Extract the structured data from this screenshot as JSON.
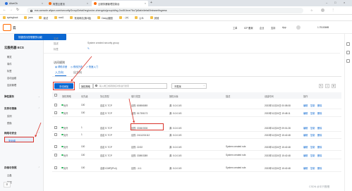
{
  "browser": {
    "tabs": [
      {
        "label": "AliveOh",
        "active": false
      },
      {
        "label": "阿里云首页",
        "active": false
      },
      {
        "label": "云服务器管理控制台",
        "active": true
      }
    ],
    "url": "ecs.console.aliyun.com/securityGroupDetail/region/cn-chengdu/groupId/sg-2vc5l1bxe76u7jx5afz/detail/intranetIngress",
    "bookmarks": [
      "springboot",
      "java",
      "我试",
      "rust1",
      "常用网站(第2组)",
      "Deep(截图",
      "…(n)",
      "公众",
      "其他"
    ]
  },
  "console": {
    "logo_text": "云",
    "popup_text": "快捷查找您想要的功能",
    "header_right": [
      "工单",
      "ICP 备案",
      "企业",
      "支持",
      "App",
      "1.75100MB"
    ]
  },
  "sidebar": {
    "title": "云服务器 ECS",
    "items_top": [
      "概览",
      "事件",
      "标签",
      "自动运维",
      "应用管理"
    ],
    "group1": "弹性服务",
    "group2": "实例与镜像",
    "group2_items": [
      "实例",
      "镜像"
    ],
    "group3": "网络与安全",
    "group3_items": [
      "安全组"
    ],
    "group4": "存储与快照",
    "group4_items": [
      "云盘",
      "快照"
    ],
    "active_item": "安全组"
  },
  "detail": {
    "rows": [
      {
        "label": "名称",
        "value": ""
      },
      {
        "label": "描述",
        "value": "System created security group"
      },
      {
        "label": "标签",
        "value": ""
      }
    ],
    "section_title": "访问规则",
    "links": [
      "帮助手册",
      "修改历史",
      "快速入门"
    ]
  },
  "rules": {
    "tab_inbound": "入方向",
    "tab_outbound": "出方向",
    "add_button": "手动添加",
    "filter_select": "授权策略",
    "filter_placeholder": "输入端口或者授权对象进行搜索",
    "sort_select": "不限序",
    "columns": [
      "授权策略",
      "优先级",
      "协议类型",
      "端口范围",
      "授权对象",
      "描述",
      "创建时间",
      "操作"
    ],
    "rows": [
      {
        "policy": "允许",
        "priority": "100",
        "protocol": "自定义 TCP",
        "port": "目的: 8089/8089",
        "source": "源: 0.0.0.0/0",
        "desc": "",
        "time": "2023年11月24日 00:08:08",
        "ops": [
          "编辑",
          "复制",
          "删除"
        ]
      },
      {
        "policy": "允许",
        "priority": "100",
        "protocol": "自定义 TCP",
        "port": "目的: 5173/5173",
        "source": "源: 0.0.0.0/0",
        "desc": "",
        "time": "2023年11月24日 19:48:11",
        "ops": [
          "编辑",
          "复制",
          "删除"
        ]
      },
      {
        "policy": "允许",
        "priority": "1",
        "protocol": "自定义 TCP",
        "port": "目的: 3306/3306",
        "source": "源: 0.0.0.0/0",
        "desc": "",
        "time": "2023年11月24日 09:01:28",
        "ops": [
          "编辑",
          "复制",
          "删除"
        ]
      },
      {
        "policy": "允许",
        "priority": "1",
        "protocol": "自定义 TCP",
        "port": "目的: 24112/24112",
        "source": "源: 0.0.0.0/0",
        "desc": "",
        "time": "2023年11月24日 15:42:48",
        "ops": [
          "编辑",
          "复制",
          "删除"
        ]
      },
      {
        "policy": "允许",
        "priority": "100",
        "protocol": "自定义 TCP",
        "port": "目的: 22/22",
        "source": "源: 0.0.0.0/0",
        "desc": "System created rule.",
        "time": "2023年11月24日 15:42:48",
        "ops": [
          "编辑",
          "复制",
          "删除"
        ]
      },
      {
        "policy": "允许",
        "priority": "100",
        "protocol": "自定义 TCP",
        "port": "目的: 3389/3389",
        "source": "源: 0.0.0.0/0",
        "desc": "System created rule.",
        "time": "2023年11月24日 15:42:48",
        "ops": [
          "编辑",
          "复制",
          "删除"
        ]
      },
      {
        "policy": "允许",
        "priority": "100",
        "protocol": "全部 ICMP(IPv4)",
        "port": "目的: -1/-1",
        "source": "源: 0.0.0.0/0",
        "desc": "System created rule.",
        "time": "2023年11月24日 15:42:48",
        "ops": [
          "编辑",
          "复制",
          "删除"
        ]
      }
    ]
  },
  "watermark": "CSDN @半只橙橙"
}
